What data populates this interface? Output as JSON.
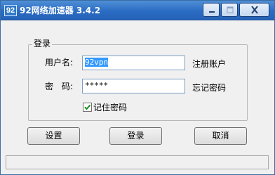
{
  "window": {
    "icon_text": "92",
    "title": "92网络加速器 3.4.2"
  },
  "login": {
    "group_title": "登录",
    "username_label": "用户名:",
    "username_value": "92vpn",
    "register_link": "注册账户",
    "password_label": "密　码:",
    "password_value": "*****",
    "forgot_link": "忘记密码",
    "remember_label": "记住密码",
    "remember_checked": true
  },
  "buttons": {
    "settings": "设置",
    "login": "登录",
    "cancel": "取消"
  },
  "colors": {
    "titlebar": "#2b6cc4",
    "selection": "#3399ff",
    "checkmark": "#1a8a1a"
  },
  "icons": [
    "minimize-icon",
    "maximize-icon",
    "close-icon",
    "checkmark-icon"
  ]
}
